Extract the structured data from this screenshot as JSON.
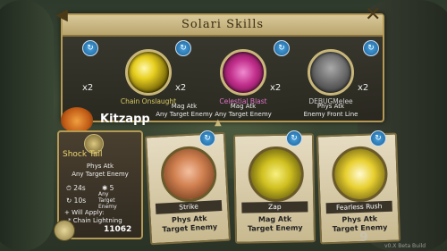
{
  "panel": {
    "title": "Solari Skills",
    "back_icon": "back-arrow-icon",
    "close_icon": "close-x-icon"
  },
  "skills": [
    {
      "name": "Chain Onslaught",
      "line1": "Mag Atk",
      "line2": "Any Target Enemy",
      "count": "x2",
      "name_color": "#d8c860"
    },
    {
      "name": "Celestial Blast",
      "line1": "Mag Atk",
      "line2": "Any Target Enemy",
      "count": "x2",
      "name_color": "#e070c8"
    },
    {
      "name": "DEBUGMelee",
      "line1": "Phys Atk",
      "line2": "Enemy Front Line",
      "count": "x2",
      "name_color": "#cccccc"
    }
  ],
  "left_count": "x2",
  "character": {
    "name": "Kitzapp"
  },
  "info": {
    "title": "Shock Tail",
    "line1": "Phys Atk",
    "line2": "Any Target Enemy",
    "time1": "24s",
    "stat1": "5",
    "time2": "10s",
    "target_line1": "Any",
    "target_line2": "Target",
    "target_line3": "Enemy",
    "will_apply": "Will Apply:",
    "effect": "Chain Lightning",
    "gold": "11062"
  },
  "cards": [
    {
      "name": "Strike",
      "line1": "Phys Atk",
      "line2": "Target Enemy"
    },
    {
      "name": "Zap",
      "line1": "Mag Atk",
      "line2": "Target Enemy"
    },
    {
      "name": "Fearless Rush",
      "line1": "Phys Atk",
      "line2": "Target Enemy"
    }
  ],
  "watermark": "9",
  "version": "v0.X Beta Build"
}
